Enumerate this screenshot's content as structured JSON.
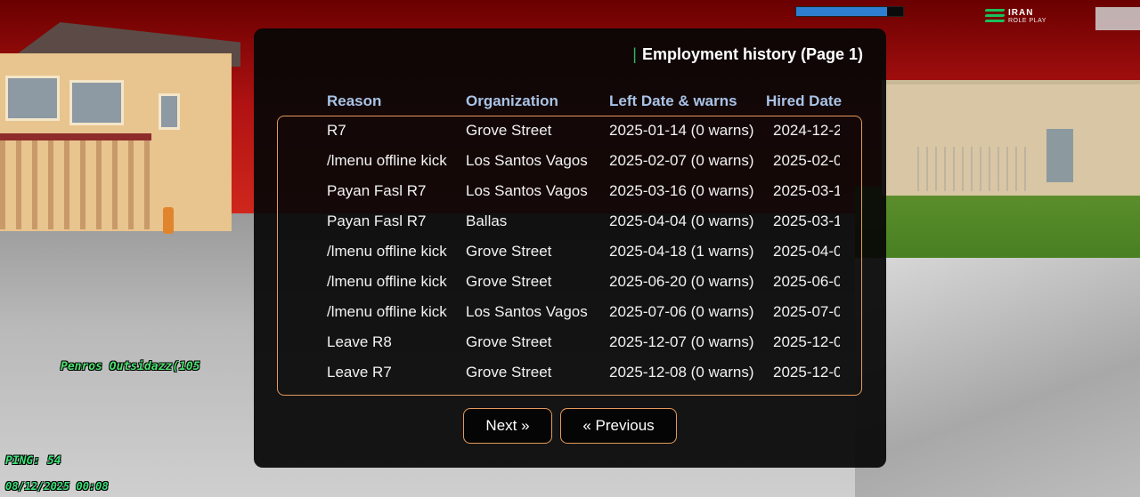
{
  "hud": {
    "health_fraction": 0.85,
    "logo_line1": "IRAN",
    "logo_line2": "ROLE PLAY",
    "player_tag": "Penros Outsidazz(105",
    "ping": "PING: 54",
    "datetime": "08/12/2025 00:08"
  },
  "dialog": {
    "title": "Employment history (Page 1)",
    "columns": {
      "reason": "Reason",
      "organization": "Organization",
      "left_date": "Left Date & warns",
      "hired_date": "Hired Date"
    },
    "rows": [
      {
        "reason": "R7",
        "organization": "Grove Street",
        "left": "2025-01-14 (0 warns)",
        "hired": "2024-12-2"
      },
      {
        "reason": "/lmenu offline kick",
        "organization": "Los Santos Vagos",
        "left": "2025-02-07 (0 warns)",
        "hired": "2025-02-0"
      },
      {
        "reason": "Payan Fasl R7",
        "organization": "Los Santos Vagos",
        "left": "2025-03-16 (0 warns)",
        "hired": "2025-03-1"
      },
      {
        "reason": "Payan Fasl R7",
        "organization": "Ballas",
        "left": "2025-04-04 (0 warns)",
        "hired": "2025-03-1"
      },
      {
        "reason": "/lmenu offline kick",
        "organization": "Grove Street",
        "left": "2025-04-18 (1 warns)",
        "hired": "2025-04-0"
      },
      {
        "reason": "/lmenu offline kick",
        "organization": "Grove Street",
        "left": "2025-06-20 (0 warns)",
        "hired": "2025-06-0"
      },
      {
        "reason": "/lmenu offline kick",
        "organization": "Los Santos Vagos",
        "left": "2025-07-06 (0 warns)",
        "hired": "2025-07-0"
      },
      {
        "reason": "Leave R8",
        "organization": "Grove Street",
        "left": "2025-12-07 (0 warns)",
        "hired": "2025-12-0"
      },
      {
        "reason": "Leave R7",
        "organization": "Grove Street",
        "left": "2025-12-08 (0 warns)",
        "hired": "2025-12-0"
      }
    ],
    "buttons": {
      "next": "Next »",
      "previous": "« Previous"
    }
  },
  "colors": {
    "accent_border": "#e49a5c",
    "scrollbar": "#f08d52",
    "header_text": "#a9c3e6",
    "title_marker": "#2fb36a",
    "hud_green": "#3de27a",
    "health_blue": "#2f7fd0"
  }
}
